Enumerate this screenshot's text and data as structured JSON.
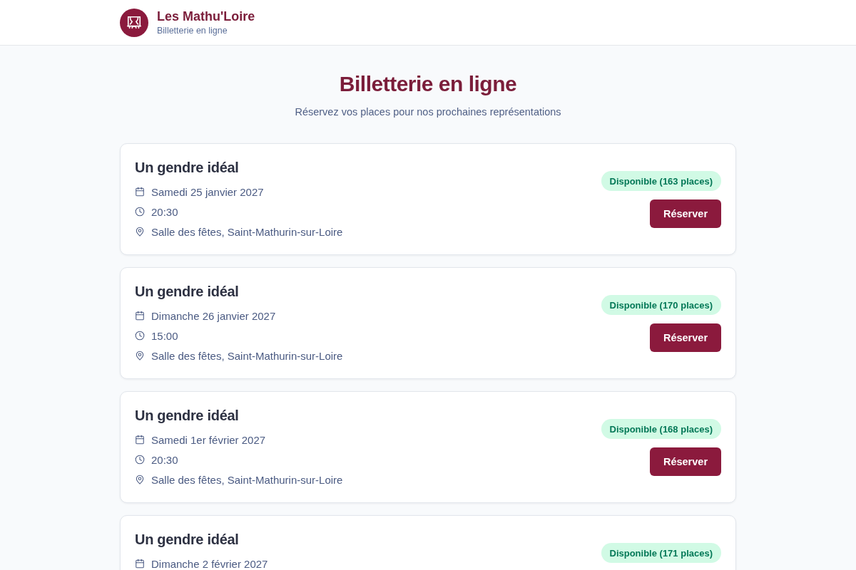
{
  "header": {
    "title": "Les Mathu'Loire",
    "subtitle": "Billetterie en ligne"
  },
  "hero": {
    "title": "Billetterie en ligne",
    "subtitle": "Réservez vos places pour nos prochaines représentations"
  },
  "events": [
    {
      "title": "Un gendre idéal",
      "details": [
        {
          "kind": "date",
          "text": "Samedi 25 janvier 2027"
        },
        {
          "kind": "time",
          "text": "20:30"
        },
        {
          "kind": "venue",
          "text": "Salle des fêtes, Saint-Mathurin-sur-Loire"
        }
      ],
      "availability": "Disponible (163 places)",
      "button": "Réserver"
    },
    {
      "title": "Un gendre idéal",
      "details": [
        {
          "kind": "date",
          "text": "Dimanche 26 janvier 2027"
        },
        {
          "kind": "time",
          "text": "15:00"
        },
        {
          "kind": "venue",
          "text": "Salle des fêtes, Saint-Mathurin-sur-Loire"
        }
      ],
      "availability": "Disponible (170 places)",
      "button": "Réserver"
    },
    {
      "title": "Un gendre idéal",
      "details": [
        {
          "kind": "date",
          "text": "Samedi 1er février 2027"
        },
        {
          "kind": "time",
          "text": "20:30"
        },
        {
          "kind": "venue",
          "text": "Salle des fêtes, Saint-Mathurin-sur-Loire"
        }
      ],
      "availability": "Disponible (168 places)",
      "button": "Réserver"
    },
    {
      "title": "Un gendre idéal",
      "details": [
        {
          "kind": "date",
          "text": "Dimanche 2 février 2027"
        }
      ],
      "availability": "Disponible (171 places)"
    }
  ]
}
